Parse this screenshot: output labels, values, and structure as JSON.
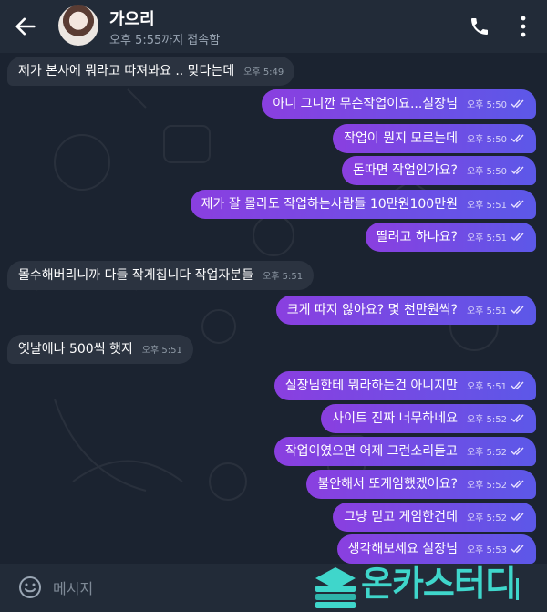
{
  "header": {
    "contact_name": "가으리",
    "status": "오후 5:55까지 접속함"
  },
  "messages": [
    {
      "dir": "in",
      "text": "제가 본사에 뭐라고 따져봐요 .. 맞다는데",
      "time": "오후 5:49"
    },
    {
      "dir": "out",
      "text": "아니 그니깐 무슨작업이요...실장님",
      "time": "오후 5:50"
    },
    {
      "dir": "out",
      "text": "작업이 뭔지 모르는데",
      "time": "오후 5:50"
    },
    {
      "dir": "out",
      "text": "돈따면 작업인가요?",
      "time": "오후 5:50"
    },
    {
      "dir": "out",
      "text": "제가 잘 몰라도 작업하는사람들 10만원100만원",
      "time": "오후 5:51"
    },
    {
      "dir": "out",
      "text": "딸려고 하나요?",
      "time": "오후 5:51"
    },
    {
      "dir": "in",
      "text": "몰수해버리니까 다들 작게칩니다 작업자분들",
      "time": "오후 5:51"
    },
    {
      "dir": "out",
      "text": "크게 따지 않아요? 몇 천만원씩?",
      "time": "오후 5:51"
    },
    {
      "dir": "in",
      "text": "옛날에나 500씩 햇지",
      "time": "오후 5:51"
    },
    {
      "dir": "out",
      "text": "실장님한테 뭐라하는건 아니지만",
      "time": "오후 5:51"
    },
    {
      "dir": "out",
      "text": "사이트 진짜 너무하네요",
      "time": "오후 5:52"
    },
    {
      "dir": "out",
      "text": "작업이였으면 어제 그런소리듣고",
      "time": "오후 5:52"
    },
    {
      "dir": "out",
      "text": "불안해서 또게임했겠어요?",
      "time": "오후 5:52"
    },
    {
      "dir": "out",
      "text": "그냥 믿고 게임한건데",
      "time": "오후 5:52"
    },
    {
      "dir": "out",
      "text": "생각해보세요 실장님",
      "time": "오후 5:53"
    }
  ],
  "input": {
    "placeholder": "메시지"
  },
  "watermark": {
    "text": "온카스터디"
  },
  "icons": {
    "back": "arrow-left-icon",
    "call": "phone-icon",
    "menu": "more-vertical-icon",
    "emoji": "smiley-icon",
    "read": "double-check-icon",
    "logo": "book-stack-logo"
  },
  "colors": {
    "outgoing_start": "#8a3fe0",
    "outgoing_end": "#5c58e8",
    "incoming": "#2b3340",
    "background": "#1b2330",
    "header": "#222b38",
    "watermark": "#3fd6cb"
  }
}
